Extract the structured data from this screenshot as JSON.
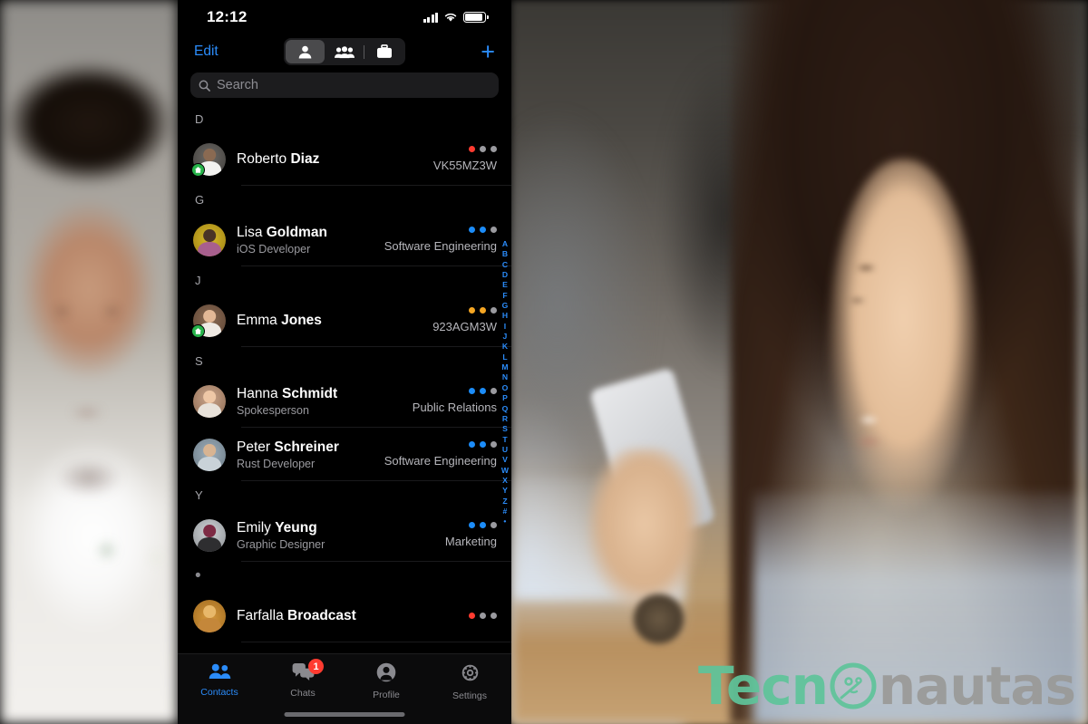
{
  "status_bar": {
    "time": "12:12",
    "signal_icon": "cellular-bars-icon",
    "wifi_icon": "wifi-icon",
    "battery_icon": "battery-icon"
  },
  "nav": {
    "edit_label": "Edit",
    "add_label": "+",
    "segments": [
      {
        "id": "person",
        "icon": "person-icon",
        "selected": true
      },
      {
        "id": "group",
        "icon": "people-group-icon",
        "selected": false
      },
      {
        "id": "work",
        "icon": "briefcase-icon",
        "selected": false
      }
    ]
  },
  "search": {
    "placeholder": "Search",
    "icon": "search-icon",
    "value": ""
  },
  "colors": {
    "accent": "#2b8cfa",
    "badge_red": "#ff3b30",
    "online_green": "#27b34a",
    "dot_red": "#ff3b30",
    "dot_orange": "#f5a623",
    "dot_blue": "#1c8cf8",
    "dot_gray": "#9a9a9f"
  },
  "index_letters": [
    "A",
    "B",
    "C",
    "D",
    "E",
    "F",
    "G",
    "H",
    "I",
    "J",
    "K",
    "L",
    "M",
    "N",
    "O",
    "P",
    "Q",
    "R",
    "S",
    "T",
    "U",
    "V",
    "W",
    "X",
    "Y",
    "Z",
    "#",
    "•"
  ],
  "sections": [
    {
      "letter": "D",
      "rows": [
        {
          "first": "Roberto",
          "last": "Diaz",
          "subtitle": "",
          "meta": "VK55MZ3W",
          "dots": [
            "#ff3b30",
            "#9a9a9f",
            "#9a9a9f"
          ],
          "avatar": "a1",
          "home_badge": true
        }
      ]
    },
    {
      "letter": "G",
      "rows": [
        {
          "first": "Lisa",
          "last": "Goldman",
          "subtitle": "iOS Developer",
          "meta": "Software Engineering",
          "dots": [
            "#1c8cf8",
            "#1c8cf8",
            "#9a9a9f"
          ],
          "avatar": "a2",
          "home_badge": false
        }
      ]
    },
    {
      "letter": "J",
      "rows": [
        {
          "first": "Emma",
          "last": "Jones",
          "subtitle": "",
          "meta": "923AGM3W",
          "dots": [
            "#f5a623",
            "#f5a623",
            "#9a9a9f"
          ],
          "avatar": "a3",
          "home_badge": true
        }
      ]
    },
    {
      "letter": "S",
      "rows": [
        {
          "first": "Hanna",
          "last": "Schmidt",
          "subtitle": "Spokesperson",
          "meta": "Public Relations",
          "dots": [
            "#1c8cf8",
            "#1c8cf8",
            "#9a9a9f"
          ],
          "avatar": "a4",
          "home_badge": false
        },
        {
          "first": "Peter",
          "last": "Schreiner",
          "subtitle": "Rust Developer",
          "meta": "Software Engineering",
          "dots": [
            "#1c8cf8",
            "#1c8cf8",
            "#9a9a9f"
          ],
          "avatar": "a5",
          "home_badge": false
        }
      ]
    },
    {
      "letter": "Y",
      "rows": [
        {
          "first": "Emily",
          "last": "Yeung",
          "subtitle": "Graphic Designer",
          "meta": "Marketing",
          "dots": [
            "#1c8cf8",
            "#1c8cf8",
            "#9a9a9f"
          ],
          "avatar": "a6",
          "home_badge": false
        }
      ]
    },
    {
      "letter": "•",
      "rows": [
        {
          "first": "Farfalla",
          "last": "Broadcast",
          "subtitle": "",
          "meta": "",
          "dots": [
            "#ff3b30",
            "#9a9a9f",
            "#9a9a9f"
          ],
          "avatar": "a7",
          "home_badge": false
        }
      ]
    }
  ],
  "tabbar": [
    {
      "label": "Contacts",
      "icon": "contacts-icon",
      "active": true,
      "badge": ""
    },
    {
      "label": "Chats",
      "icon": "chat-bubbles-icon",
      "active": false,
      "badge": "1"
    },
    {
      "label": "Profile",
      "icon": "person-circle-icon",
      "active": false,
      "badge": ""
    },
    {
      "label": "Settings",
      "icon": "gear-icon",
      "active": false,
      "badge": ""
    }
  ],
  "watermark": {
    "part1": "Tecn",
    "part2": "nautas",
    "logo_icon": "astronaut-helmet-logo-icon"
  }
}
